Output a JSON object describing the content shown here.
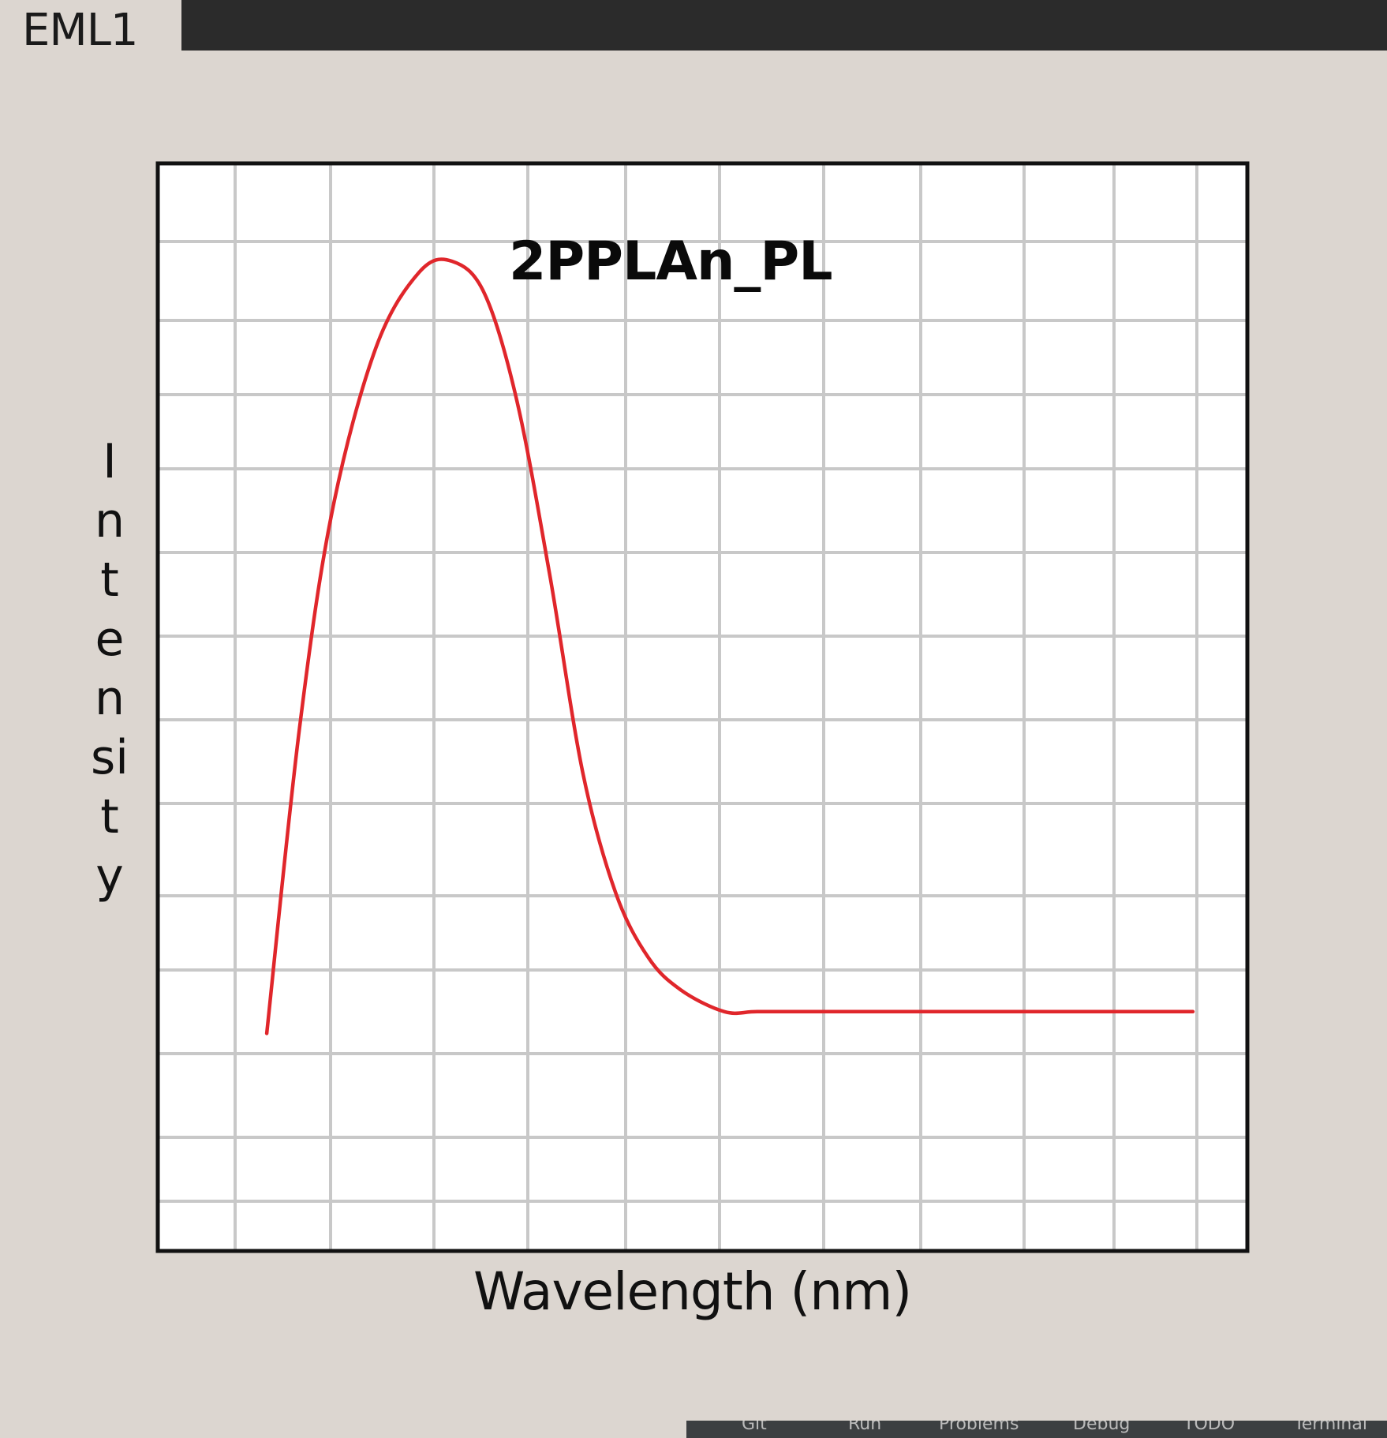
{
  "tab": {
    "label": "EML1"
  },
  "colors": {
    "background": "#dcd6d0",
    "tabbar": "#2b2b2b",
    "plot_bg": "#ffffff",
    "grid": "#c8c8c8",
    "frame": "#111111",
    "line": "#e0262b"
  },
  "chart_data": {
    "type": "line",
    "title": "2PPLAn_PL",
    "xlabel": "Wavelength (nm)",
    "ylabel": "Intensity",
    "grid": true,
    "series": [
      {
        "x": [
          0.1,
          0.13,
          0.16,
          0.2,
          0.24,
          0.27,
          0.3,
          0.33,
          0.36,
          0.39,
          0.42,
          0.45,
          0.48,
          0.52,
          0.55,
          0.6,
          0.7,
          0.8,
          0.9,
          0.95
        ],
        "y": [
          0.2,
          0.48,
          0.68,
          0.83,
          0.9,
          0.91,
          0.88,
          0.78,
          0.62,
          0.44,
          0.33,
          0.27,
          0.24,
          0.22,
          0.22,
          0.22,
          0.22,
          0.22,
          0.22,
          0.22
        ],
        "color": "#e0262b"
      }
    ]
  },
  "statusbar": {
    "items": [
      "Git",
      "Run",
      "Problems",
      "Debug",
      "TODO",
      "Terminal"
    ]
  }
}
